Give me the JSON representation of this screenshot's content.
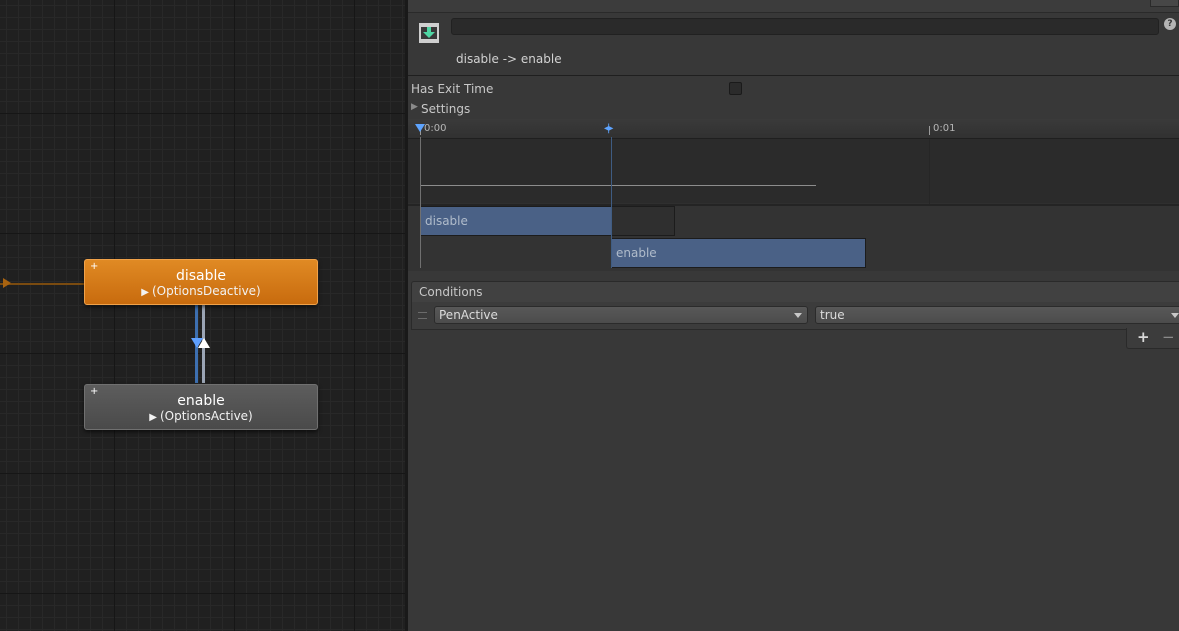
{
  "graph": {
    "states": [
      {
        "name": "disable",
        "motion": "(OptionsDeactive)",
        "is_default": true
      },
      {
        "name": "enable",
        "motion": "(OptionsActive)",
        "is_default": false
      }
    ],
    "plus_glyph": "+",
    "play_glyph": "▶",
    "colors": {
      "default_state": "#d87c1a",
      "normal_state": "#545454",
      "selected_transition": "#3d6fb0"
    }
  },
  "inspector": {
    "transition_name": "disable -> enable",
    "name_field_value": "",
    "help_glyph": "?",
    "has_exit_time_label": "Has Exit Time",
    "has_exit_time_checked": false,
    "settings_label": "Settings",
    "settings_expanded": false,
    "settings_glyph": "▶"
  },
  "timeline": {
    "ruler_labels": [
      "0:00",
      "0:01"
    ],
    "source_clip": "disable",
    "destination_clip": "enable"
  },
  "conditions": {
    "title": "Conditions",
    "items": [
      {
        "parameter": "PenActive",
        "value": "true"
      }
    ],
    "add_label": "+",
    "remove_label": "−"
  }
}
